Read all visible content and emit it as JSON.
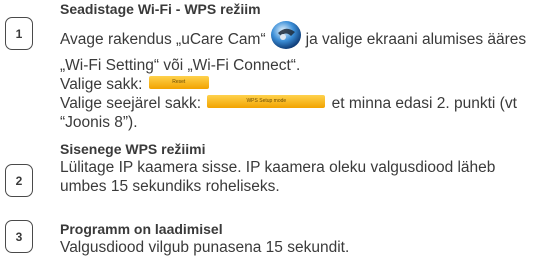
{
  "steps": [
    {
      "number": "1",
      "title": "Seadistage Wi-Fi - WPS režiim",
      "line1_before": "Avage rakendus „uCare Cam“",
      "line1_after": "ja valige ekraani alumises ääres",
      "line2": "„Wi-Fi Setting“ või „Wi-Fi Connect“.",
      "line3": "Valige sakk:",
      "tab1_label": "Reset",
      "line4_before": "Valige seejärel sakk:",
      "tab2_label": "WPS Setup mode",
      "line4_after": "et minna edasi 2. punkti (vt",
      "line5": "“Joonis 8”).",
      "app_icon": "ucare-cam-app-icon"
    },
    {
      "number": "2",
      "title": "Sisenege WPS režiimi",
      "line1": "Lülitage IP kaamera sisse. IP kaamera oleku valgusdiood läheb",
      "line2": "umbes 15 sekundiks roheliseks."
    },
    {
      "number": "3",
      "title": "Programm on laadimisel",
      "line1": "Valgusdiood vilgub punasena 15 sekundit."
    }
  ],
  "colors": {
    "text": "#3a3a3a",
    "tab": "#f7b500"
  }
}
